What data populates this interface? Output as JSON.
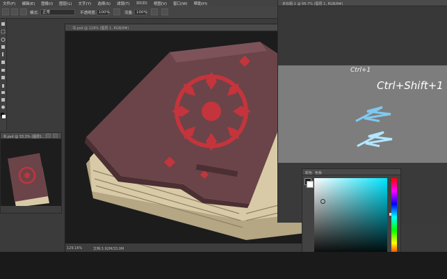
{
  "menu": [
    "文件(F)",
    "编辑(E)",
    "图像(I)",
    "图层(L)",
    "文字(Y)",
    "选择(S)",
    "滤镜(T)",
    "3D(D)",
    "视图(V)",
    "窗口(W)",
    "帮助(H)"
  ],
  "options": {
    "mode_label": "模式:",
    "mode_value": "正常",
    "opacity_label": "不透明度:",
    "opacity_value": "100%",
    "flow_label": "流量:",
    "flow_value": "100%"
  },
  "main_doc": {
    "tab": "书.psd @ 129% (图层 1, RGB/8#)",
    "zoom": "129.16%",
    "docsize": "文档:3.92M/33.0M"
  },
  "nav_doc": {
    "tab": "书.psd @ 33.3% (图层1...)"
  },
  "right_doc": {
    "tab": "未标题-1 @ 66.7% (图层 1, RGB/8#)",
    "left_scribble": "Ctrl+1",
    "right_scribble": "Ctrl+Shift+1"
  },
  "color_picker": {
    "tab1": "颜色",
    "tab2": "色板",
    "hue_color": "#00e5ff"
  },
  "colors": {
    "canvas_bg": "#1c1c1c",
    "book_cover": "#6a4448",
    "emblem": "#c4343c",
    "pages": "#d8caa6"
  }
}
